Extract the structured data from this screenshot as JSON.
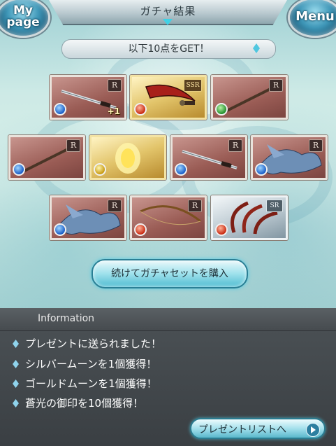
{
  "header": {
    "title": "ガチャ結果",
    "mypage_line1": "My",
    "mypage_line2": "page",
    "menu_label": "Menu"
  },
  "banner": {
    "text": "以下10点をGET！"
  },
  "cards": [
    {
      "rarity": "R",
      "element": "water",
      "item": "katana",
      "plus": "+1"
    },
    {
      "rarity": "SSR",
      "element": "fire",
      "item": "curved-sword",
      "plus": ""
    },
    {
      "rarity": "R",
      "element": "wind",
      "item": "staff",
      "plus": ""
    },
    {
      "rarity": "R",
      "element": "water",
      "item": "staff",
      "plus": ""
    },
    {
      "rarity": "",
      "element": "light",
      "item": "golden-moon",
      "plus": ""
    },
    {
      "rarity": "R",
      "element": "water",
      "item": "katana",
      "plus": ""
    },
    {
      "rarity": "R",
      "element": "water",
      "item": "dragon-summon",
      "plus": ""
    },
    {
      "rarity": "R",
      "element": "water",
      "item": "dragon-summon",
      "plus": ""
    },
    {
      "rarity": "R",
      "element": "fire",
      "item": "bow",
      "plus": ""
    },
    {
      "rarity": "SR",
      "element": "fire",
      "item": "claw-summon",
      "plus": ""
    }
  ],
  "buy_button": {
    "label": "続けてガチャセットを購入"
  },
  "info": {
    "title": "Information",
    "lines": [
      "プレゼントに送られました！",
      "シルバームーンを1個獲得！",
      "ゴールドムーンを1個獲得！",
      "蒼光の御印を10個獲得！"
    ]
  },
  "present_button": {
    "label": "プレゼントリストへ"
  },
  "colors": {
    "accent": "#4fbcd1",
    "panel": "#3a3f43",
    "card_r": "#9a5c55",
    "card_ssr": "#e2c46a",
    "card_sr": "#b9c7cf"
  }
}
